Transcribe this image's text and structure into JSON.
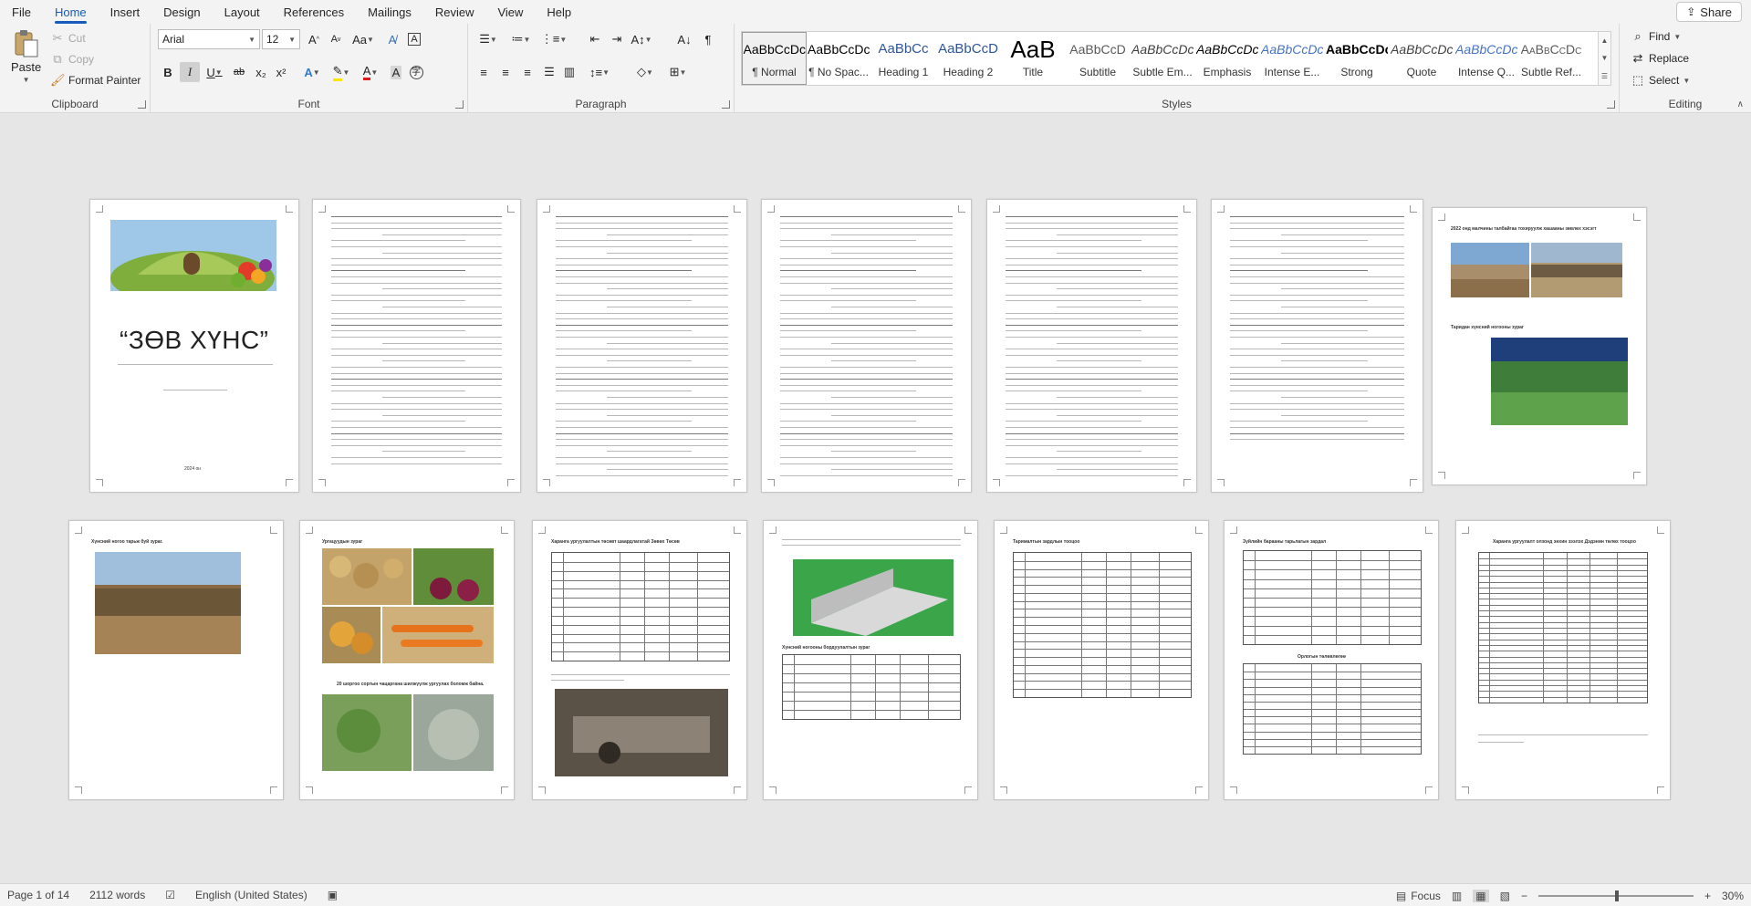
{
  "menu": {
    "tabs": [
      "File",
      "Home",
      "Insert",
      "Design",
      "Layout",
      "References",
      "Mailings",
      "Review",
      "View",
      "Help"
    ],
    "active_tab": "Home",
    "share_label": "Share"
  },
  "clipboard": {
    "paste": "Paste",
    "cut": "Cut",
    "copy": "Copy",
    "format_painter": "Format Painter",
    "label": "Clipboard"
  },
  "font": {
    "name": "Arial",
    "size": "12",
    "grow": "A",
    "shrink": "A",
    "change_case": "Aa",
    "bold": "B",
    "italic": "I",
    "underline": "U",
    "strike": "ab",
    "subscript": "x₂",
    "superscript": "x²",
    "label": "Font"
  },
  "paragraph": {
    "label": "Paragraph"
  },
  "styles": {
    "label": "Styles",
    "items": [
      {
        "preview": "AaBbCcDc",
        "name": "¶ Normal",
        "color": "#000000"
      },
      {
        "preview": "AaBbCcDc",
        "name": "¶ No Spac...",
        "color": "#000000"
      },
      {
        "preview": "AaBbCc",
        "name": "Heading 1",
        "color": "#2f5597"
      },
      {
        "preview": "AaBbCcD",
        "name": "Heading 2",
        "color": "#2f5597"
      },
      {
        "preview": "AaB",
        "name": "Title",
        "color": "#000000"
      },
      {
        "preview": "AaBbCcD",
        "name": "Subtitle",
        "color": "#595959"
      },
      {
        "preview": "AaBbCcDc",
        "name": "Subtle Em...",
        "color": "#404040"
      },
      {
        "preview": "AaBbCcDc",
        "name": "Emphasis",
        "color": "#000000"
      },
      {
        "preview": "AaBbCcDc",
        "name": "Intense E...",
        "color": "#4472c4"
      },
      {
        "preview": "AaBbCcDc",
        "name": "Strong",
        "color": "#000000"
      },
      {
        "preview": "AaBbCcDc",
        "name": "Quote",
        "color": "#404040"
      },
      {
        "preview": "AaBbCcDc",
        "name": "Intense Q...",
        "color": "#4472c4"
      },
      {
        "preview": "AaBbCcDc",
        "name": "Subtle Ref...",
        "color": "#595959"
      }
    ]
  },
  "editing": {
    "find": "Find",
    "replace": "Replace",
    "select": "Select",
    "label": "Editing"
  },
  "document": {
    "cover_title": "“ЗӨВ ХҮНС”",
    "cover_year": "2024 он",
    "p9_caption": "Хүнсний ногоо тарьж буй зураг.",
    "p10_caption": "Ургацуудын зураг",
    "p7_caption": "2022 онд малчины талбайгаа тохируулж хашааны зөвлөх хэсэгт",
    "p12_caption": "Хүнсний ногооны бордуулалтын зураг"
  },
  "status": {
    "page": "Page 1 of 14",
    "words": "2112 words",
    "language": "English (United States)",
    "focus": "Focus",
    "zoom": "30%"
  }
}
